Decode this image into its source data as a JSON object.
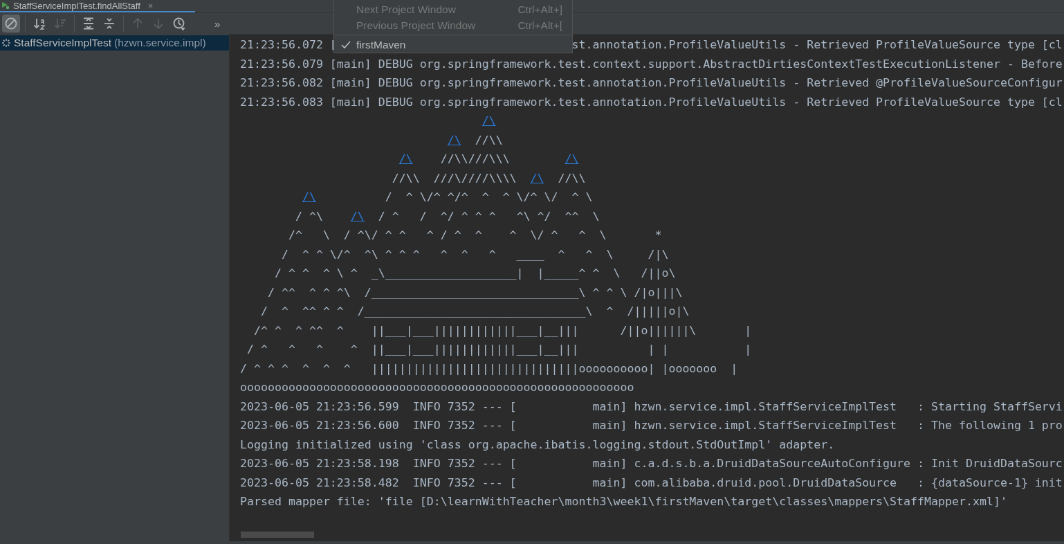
{
  "run_tab": {
    "title": "StaffServiceImplTest.findAllStaff",
    "close": "×"
  },
  "toolbar": [
    {
      "kind": "circle-slash",
      "selected": true,
      "disabled": false
    },
    {
      "kind": "sort-alpha",
      "selected": false,
      "disabled": false
    },
    {
      "kind": "sort-duration",
      "selected": false,
      "disabled": true
    },
    {
      "kind": "expand-all",
      "selected": false,
      "disabled": false
    },
    {
      "kind": "collapse-all",
      "selected": false,
      "disabled": false
    },
    {
      "kind": "up",
      "selected": false,
      "disabled": true
    },
    {
      "kind": "down",
      "selected": false,
      "disabled": true
    },
    {
      "kind": "history",
      "selected": false,
      "disabled": false
    }
  ],
  "toolbar_more": "»",
  "test_tree": [
    {
      "name": "StaffServiceImplTest",
      "package": "(hzwn.service.impl)",
      "selected": true,
      "running": true
    }
  ],
  "console": {
    "lines": [
      {
        "kind": "split",
        "left": "21:23:56.072 [",
        "right": "st.annotation.ProfileValueUtils - Retrieved ProfileValueSource type [cl"
      },
      {
        "kind": "plain",
        "text": "21:23:56.079 [main] DEBUG org.springframework.test.context.support.AbstractDirtiesContextTestExecutionListener - Before"
      },
      {
        "kind": "plain",
        "text": "21:23:56.082 [main] DEBUG org.springframework.test.annotation.ProfileValueUtils - Retrieved @ProfileValueSourceConfigur"
      },
      {
        "kind": "plain",
        "text": "21:23:56.083 [main] DEBUG org.springframework.test.annotation.ProfileValueUtils - Retrieved ProfileValueSource type [cl"
      },
      {
        "kind": "art",
        "segments": [
          {
            "text": "                                   /\\",
            "link": true
          }
        ]
      },
      {
        "kind": "art",
        "segments": [
          {
            "text": "                              /\\",
            "link": true
          },
          {
            "text": "  //\\\\",
            "link": false
          }
        ]
      },
      {
        "kind": "art",
        "segments": [
          {
            "text": "                       /\\",
            "link": true
          },
          {
            "text": "    //\\\\///\\\\\\        ",
            "link": false
          },
          {
            "text": "/\\",
            "link": true
          }
        ]
      },
      {
        "kind": "art",
        "segments": [
          {
            "text": "                      //\\\\  ///\\////\\\\\\\\  ",
            "link": false
          },
          {
            "text": "/\\",
            "link": true
          },
          {
            "text": "  //\\\\",
            "link": false
          }
        ]
      },
      {
        "kind": "art",
        "segments": [
          {
            "text": "         /\\",
            "link": true
          },
          {
            "text": "          /  ^ \\/^ ^/^  ^  ^ \\/^ \\/  ^ \\",
            "link": false
          }
        ]
      },
      {
        "kind": "art",
        "segments": [
          {
            "text": "        / ^\\    ",
            "link": false
          },
          {
            "text": "/\\",
            "link": true
          },
          {
            "text": "  / ^   /  ^/ ^ ^ ^   ^\\ ^/  ^^  \\",
            "link": false
          }
        ]
      },
      {
        "kind": "art",
        "segments": [
          {
            "text": "       /^   \\  / ^\\/ ^ ^   ^ / ^  ^    ^  \\/ ^   ^  \\       *",
            "link": false
          }
        ]
      },
      {
        "kind": "art",
        "segments": [
          {
            "text": "      /  ^ ^ \\/^  ^\\ ^ ^ ^   ^  ^   ^   ____  ^   ^  \\     /|\\",
            "link": false
          }
        ]
      },
      {
        "kind": "art",
        "segments": [
          {
            "text": "     / ^ ^  ^ \\ ^  _\\___________________|  |_____^ ^  \\   /||o\\",
            "link": false
          }
        ]
      },
      {
        "kind": "art",
        "segments": [
          {
            "text": "    / ^^  ^ ^ ^\\  /______________________________\\ ^ ^ \\ /|o|||\\",
            "link": false
          }
        ]
      },
      {
        "kind": "art",
        "segments": [
          {
            "text": "   /  ^  ^^ ^ ^  /________________________________\\  ^  /|||||o|\\",
            "link": false
          }
        ]
      },
      {
        "kind": "art",
        "segments": [
          {
            "text": "  /^ ^  ^ ^^  ^    ||___|___||||||||||||___|__|||      /||o||||||\\       |",
            "link": false
          }
        ]
      },
      {
        "kind": "art",
        "segments": [
          {
            "text": " / ^   ^   ^    ^  ||___|___||||||||||||___|__|||          | |           |",
            "link": false
          }
        ]
      },
      {
        "kind": "art",
        "segments": [
          {
            "text": "/ ^ ^ ^  ^  ^  ^   ||||||||||||||||||||||||||||||oooooooooo| |ooooooo  |",
            "link": false
          }
        ]
      },
      {
        "kind": "art",
        "segments": [
          {
            "text": "ooooooooooooooooooooooooooooooooooooooooooooooooooooooooo",
            "link": false
          }
        ]
      },
      {
        "kind": "plain",
        "text": "2023-06-05 21:23:56.599  INFO 7352 --- [           main] hzwn.service.impl.StaffServiceImplTest   : Starting StaffServi"
      },
      {
        "kind": "plain",
        "text": "2023-06-05 21:23:56.600  INFO 7352 --- [           main] hzwn.service.impl.StaffServiceImplTest   : The following 1 pro"
      },
      {
        "kind": "plain",
        "text": "Logging initialized using 'class org.apache.ibatis.logging.stdout.StdOutImpl' adapter."
      },
      {
        "kind": "plain",
        "text": "2023-06-05 21:23:58.198  INFO 7352 --- [           main] c.a.d.s.b.a.DruidDataSourceAutoConfigure : Init DruidDataSourc"
      },
      {
        "kind": "plain",
        "text": "2023-06-05 21:23:58.482  INFO 7352 --- [           main] com.alibaba.druid.pool.DruidDataSource   : {dataSource-1} init"
      },
      {
        "kind": "plain",
        "text": "Parsed mapper file: 'file [D:\\learnWithTeacher\\month3\\week1\\firstMaven\\target\\classes\\mappers\\StaffMapper.xml]'"
      }
    ]
  },
  "window_menu": {
    "items": [
      {
        "label": "Next Project Window",
        "shortcut": "Ctrl+Alt+]",
        "checked": false,
        "disabled": true
      },
      {
        "label": "Previous Project Window",
        "shortcut": "Ctrl+Alt+[",
        "checked": false,
        "disabled": true
      },
      {
        "label": "firstMaven",
        "checked": true,
        "disabled": false
      }
    ]
  }
}
